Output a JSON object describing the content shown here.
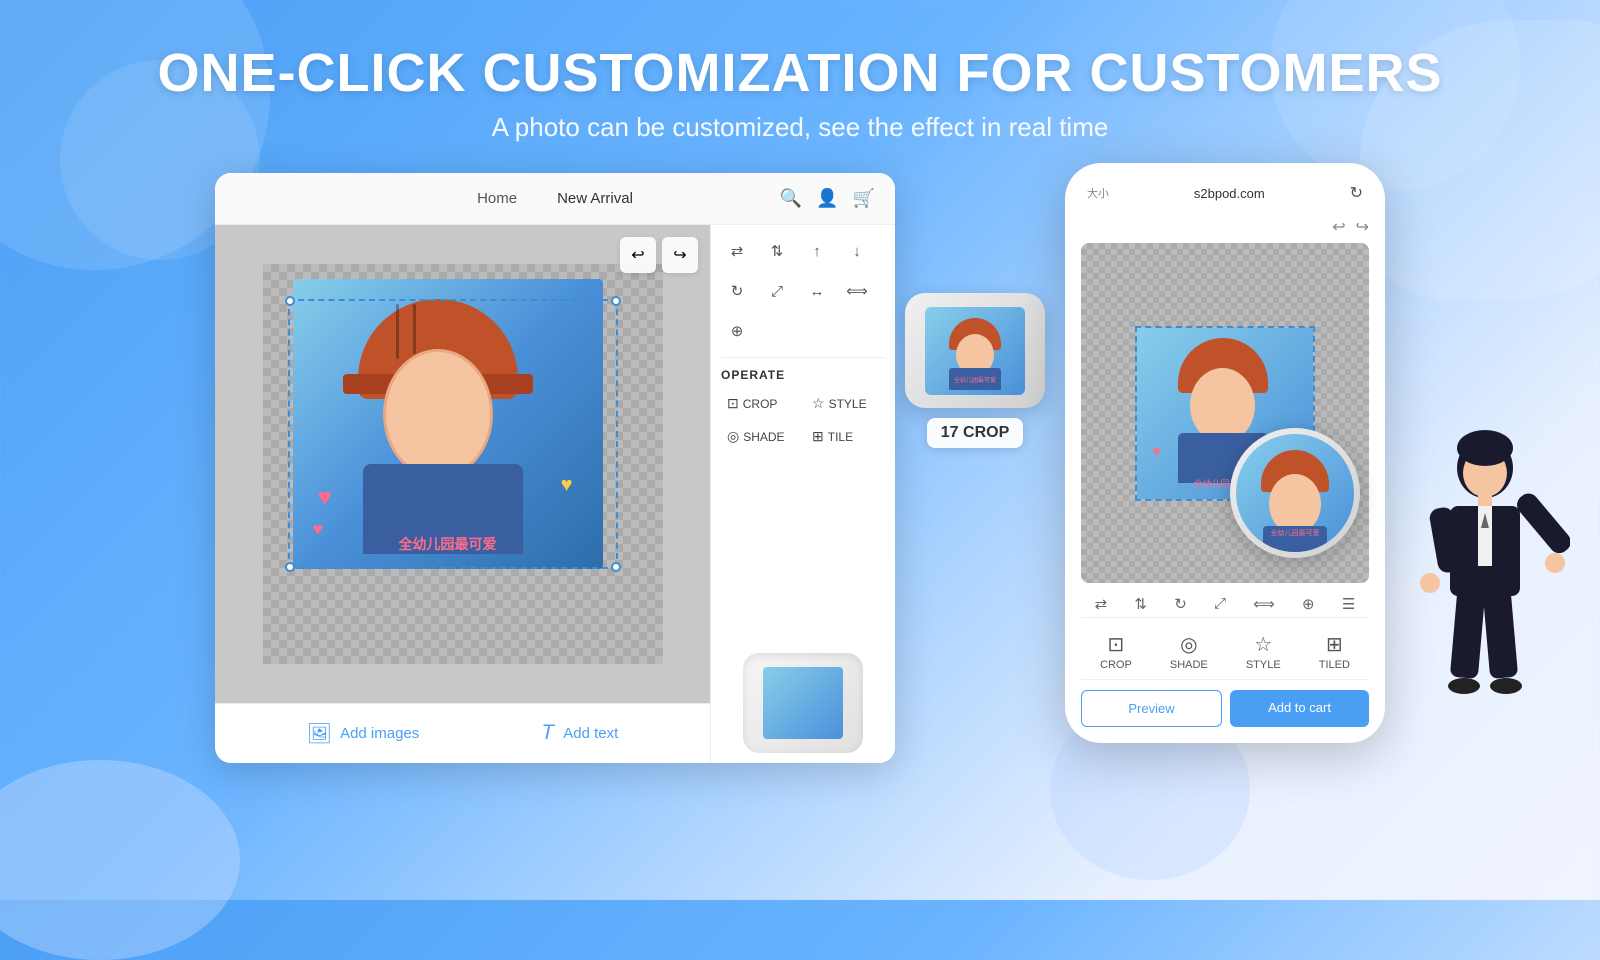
{
  "page": {
    "main_title": "ONE-CLICK CUSTOMIZATION FOR CUSTOMERS",
    "sub_title": "A photo can be customized, see the effect in real time"
  },
  "nav": {
    "home": "Home",
    "new_arrival": "New Arrival",
    "address": "s2bpod.com"
  },
  "editor": {
    "operate_label": "OPERATE",
    "crop_label": "CROP",
    "style_label": "STYLE",
    "shade_label": "SHADE",
    "tile_label": "TILE",
    "add_images": "Add images",
    "add_text": "Add text",
    "crop_badge": "17 CROP",
    "chinese_art_text": "全幼儿园最可爱"
  },
  "phone": {
    "preview_btn": "Preview",
    "add_to_cart_btn": "Add to cart",
    "address": "s2bpod.com",
    "crop_label": "CROP",
    "shade_label": "SHADE",
    "style_label": "STYLE",
    "tiled_label": "TILED"
  },
  "colors": {
    "accent": "#4a9ff5",
    "white": "#ffffff",
    "text_dark": "#222222"
  }
}
